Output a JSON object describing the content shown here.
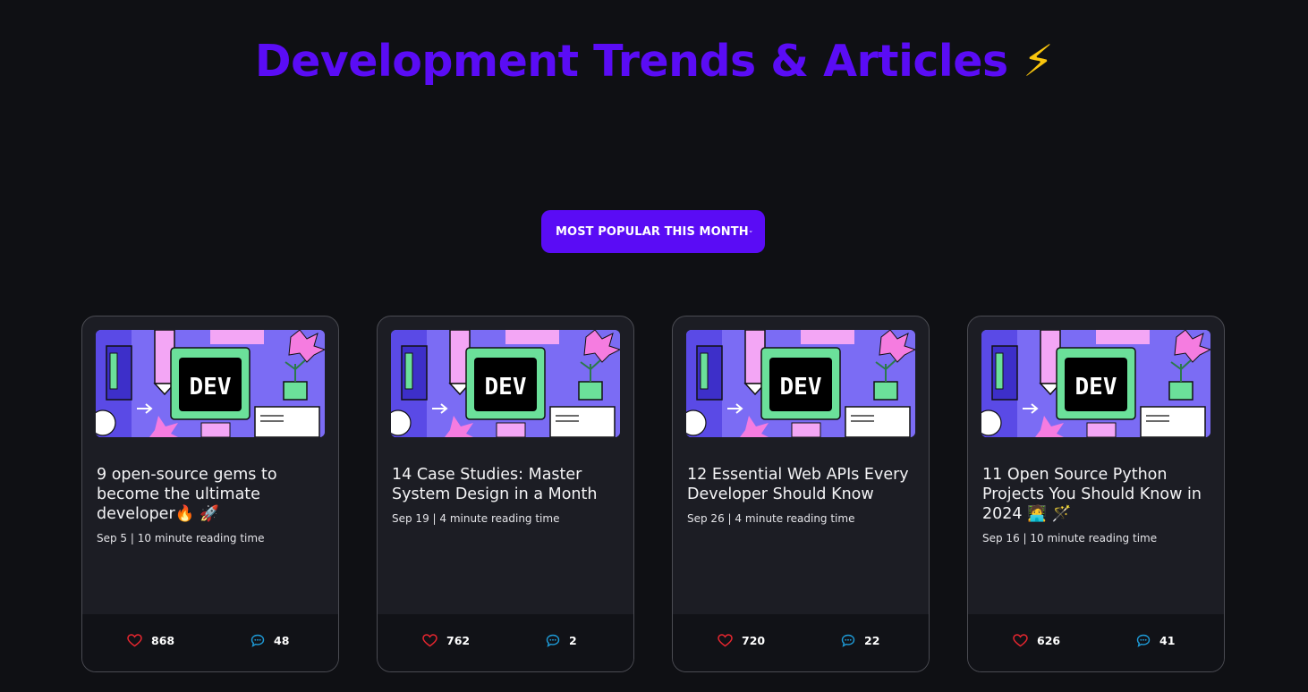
{
  "header": {
    "title": "Development Trends & Articles",
    "emoji": "⚡"
  },
  "filter": {
    "selected": "MOST POPULAR THIS MONTH"
  },
  "colors": {
    "accent": "#5a0cf5",
    "background": "#0f1014",
    "card": "#1c1d24",
    "heart": "#e5262f",
    "comment": "#1e9ad6"
  },
  "articles": [
    {
      "title": "9 open-source gems to become the ultimate developer🔥 🚀",
      "meta": "Sep 5 | 10 minute reading time",
      "likes": "868",
      "comments": "48",
      "thumb_text": "DEV"
    },
    {
      "title": "14 Case Studies: Master System Design in a Month",
      "meta": "Sep 19 | 4 minute reading time",
      "likes": "762",
      "comments": "2",
      "thumb_text": "DEV"
    },
    {
      "title": "12 Essential Web APIs Every Developer Should Know",
      "meta": "Sep 26 | 4 minute reading time",
      "likes": "720",
      "comments": "22",
      "thumb_text": "DEV"
    },
    {
      "title": "11 Open Source Python Projects You Should Know in 2024 🧑‍💻 🪄",
      "meta": "Sep 16 | 10 minute reading time",
      "likes": "626",
      "comments": "41",
      "thumb_text": "DEV"
    }
  ]
}
